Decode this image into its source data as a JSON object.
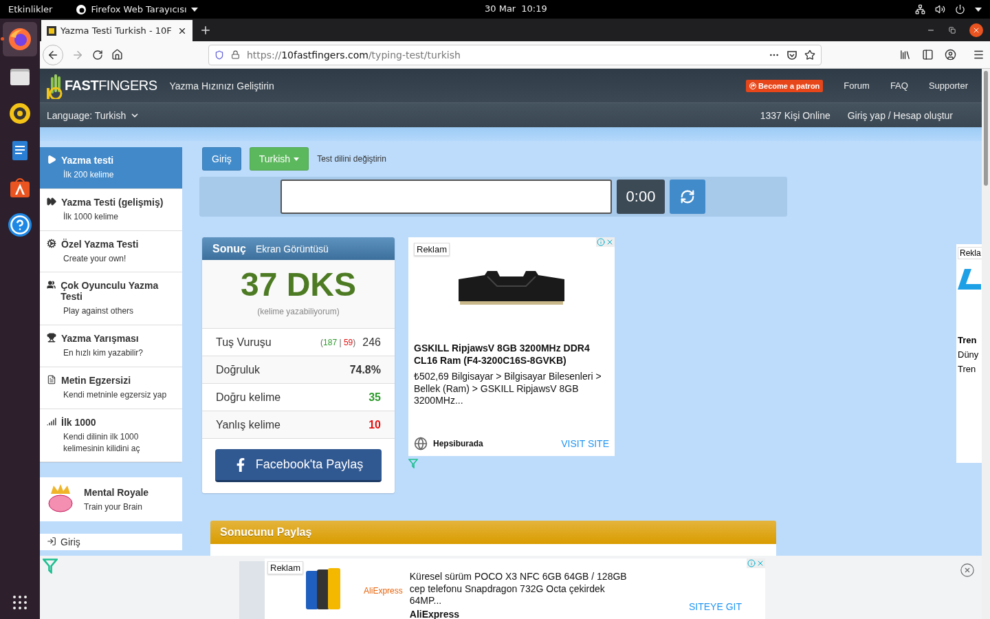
{
  "topbar": {
    "activities": "Etkinlikler",
    "app": "Firefox Web Tarayıcısı",
    "date": "30 Mar",
    "time": "10:19"
  },
  "dock": [
    {
      "kind": "firefox",
      "selected": true
    },
    {
      "kind": "files",
      "selected": false
    },
    {
      "kind": "rhythmbox",
      "selected": false
    },
    {
      "kind": "writer",
      "selected": false
    },
    {
      "kind": "software",
      "selected": false
    },
    {
      "kind": "help",
      "selected": false
    }
  ],
  "browser": {
    "tab_title": "Yazma Testi Turkish - 10F",
    "url_scheme": "https://",
    "url_host": "10fastfingers.com",
    "url_path": "/typing-test/turkish"
  },
  "site": {
    "logo_bold": "FAST",
    "logo_light": "FINGERS",
    "tagline": "Yazma Hızınızı Geliştirin",
    "patreon": "Become a patron",
    "nav": [
      "Forum",
      "FAQ",
      "Supporter"
    ],
    "language": "Language: Turkish",
    "online": "1337 Kişi Online",
    "account": "Giriş yap / Hesap oluştur"
  },
  "sidebar": {
    "items": [
      {
        "kind": "play",
        "title": "Yazma testi",
        "subtitle": "İlk 200 kelime",
        "selected": true
      },
      {
        "kind": "forward",
        "title": "Yazma Testi (gelişmiş)",
        "subtitle": "İlk 1000 kelime",
        "selected": false
      },
      {
        "kind": "gears",
        "title": "Özel Yazma Testi",
        "subtitle": "Create your own!",
        "selected": false
      },
      {
        "kind": "users",
        "title": "Çok Oyunculu Yazma Testi",
        "subtitle": "Play against others",
        "selected": false
      },
      {
        "kind": "trophy",
        "title": "Yazma Yarışması",
        "subtitle": "En hızlı kim yazabilir?",
        "selected": false
      },
      {
        "kind": "document",
        "title": "Metin Egzersizi",
        "subtitle": "Kendi metninle egzersiz yap",
        "selected": false
      },
      {
        "kind": "signal",
        "title": "İlk 1000",
        "subtitle": "Kendi dilinin ilk 1000 kelimesinin kilidini aç",
        "selected": false
      }
    ],
    "promo": {
      "title": "Mental Royale",
      "subtitle": "Train your Brain"
    },
    "login": "Giriş"
  },
  "toolbar": {
    "login": "Giriş",
    "language": "Turkish",
    "hint": "Test dilini değiştirin",
    "timer": "0:00"
  },
  "result": {
    "title": "Sonuç",
    "tab": "Ekran Görüntüsü",
    "wpm": "37 DKS",
    "note": "(kelime yazabiliyorum)",
    "rows": [
      {
        "label": "Tuş Vuruşu",
        "kind": "split",
        "value": "246",
        "breakdown": [
          {
            "text": "(",
            "kind": "plain"
          },
          {
            "text": "187",
            "kind": "good"
          },
          {
            "text": " | ",
            "kind": "plain"
          },
          {
            "text": "59",
            "kind": "bad"
          },
          {
            "text": ")",
            "kind": "plain"
          }
        ]
      },
      {
        "label": "Doğruluk",
        "kind": "plain",
        "value": "74.8%"
      },
      {
        "label": "Doğru kelime",
        "kind": "good",
        "value": "35"
      },
      {
        "label": "Yanlış kelime",
        "kind": "bad",
        "value": "10"
      }
    ],
    "share": "Facebook'ta Paylaş"
  },
  "ad": {
    "label": "Reklam",
    "title": "GSKILL RipjawsV 8GB 3200MHz DDR4 CL16 Ram (F4-3200C16S-8GVKB)",
    "description": "₺502,69 Bilgisayar > Bilgisayar Bilesenleri > Bellek (Ram) > GSKILL RipjawsV 8GB 3200MHz...",
    "source": "Hepsiburada",
    "cta": "VISIT SITE"
  },
  "side_ad": {
    "label": "Rekla",
    "title": "Tren",
    "lines": [
      "Düny",
      "Tren"
    ]
  },
  "share_section": {
    "title": "Sonucunu Paylaş"
  },
  "bottom_ad": {
    "label": "Reklam",
    "brand": "AliExpress",
    "title": "Küresel sürüm POCO X3 NFC 6GB 64GB / 128GB cep telefonu Snapdragon 732G Octa çekirdek 64MP...",
    "source": "AliExpress",
    "cta": "SITEYE GIT"
  }
}
